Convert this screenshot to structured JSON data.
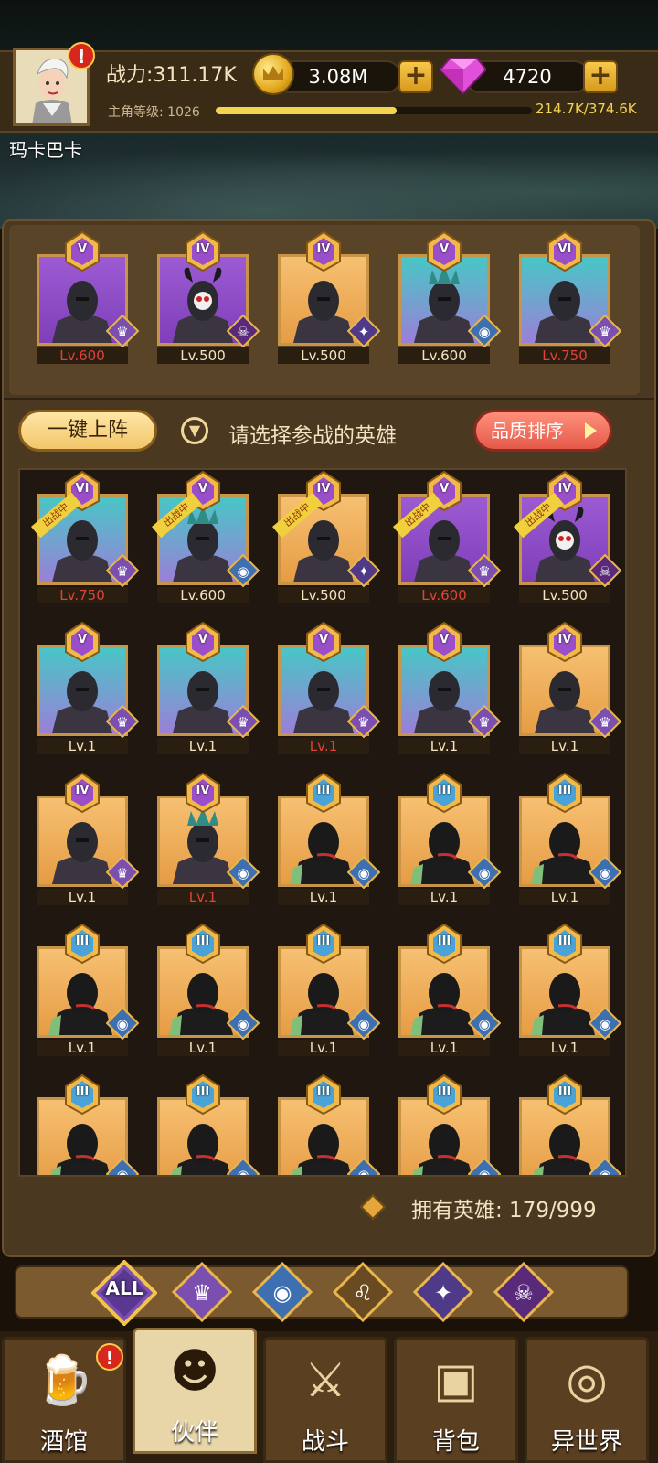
{
  "player": {
    "name": "玛卡巴卡",
    "power": "战力:311.17K",
    "level_label": "主角等级: 1026",
    "exp_text": "214.7K/374.6K",
    "exp_progress": 0.573
  },
  "resources": {
    "gold": "3.08M",
    "gems": "4720"
  },
  "team": [
    {
      "rank": "V",
      "level": "Lv.600",
      "level_red": true,
      "bg": "purple",
      "faction": "crown"
    },
    {
      "rank": "IV",
      "level": "Lv.500",
      "level_red": false,
      "bg": "purple",
      "faction": "demon"
    },
    {
      "rank": "IV",
      "level": "Lv.500",
      "level_red": false,
      "bg": "orange",
      "faction": "elf"
    },
    {
      "rank": "V",
      "level": "Lv.600",
      "level_red": false,
      "bg": "teal",
      "faction": "fish"
    },
    {
      "rank": "VI",
      "level": "Lv.750",
      "level_red": true,
      "bg": "teal",
      "faction": "crown"
    }
  ],
  "controls": {
    "auto_deploy": "一键上阵",
    "prompt": "请选择参战的英雄",
    "sort": "品质排序"
  },
  "heroes": [
    {
      "rank": "VI",
      "level": "Lv.750",
      "level_red": true,
      "bg": "teal",
      "faction": "crown",
      "deployed": "出战中"
    },
    {
      "rank": "V",
      "level": "Lv.600",
      "level_red": false,
      "bg": "teal",
      "faction": "fish",
      "deployed": "出战中"
    },
    {
      "rank": "IV",
      "level": "Lv.500",
      "level_red": false,
      "bg": "orange",
      "faction": "elf",
      "deployed": "出战中"
    },
    {
      "rank": "V",
      "level": "Lv.600",
      "level_red": true,
      "bg": "purple",
      "faction": "crown",
      "deployed": "出战中"
    },
    {
      "rank": "IV",
      "level": "Lv.500",
      "level_red": false,
      "bg": "purple",
      "faction": "demon",
      "deployed": "出战中"
    },
    {
      "rank": "V",
      "level": "Lv.1",
      "level_red": false,
      "bg": "teal",
      "faction": "crown",
      "deployed": ""
    },
    {
      "rank": "V",
      "level": "Lv.1",
      "level_red": false,
      "bg": "teal",
      "faction": "crown",
      "deployed": ""
    },
    {
      "rank": "V",
      "level": "Lv.1",
      "level_red": true,
      "bg": "teal",
      "faction": "crown",
      "deployed": ""
    },
    {
      "rank": "V",
      "level": "Lv.1",
      "level_red": false,
      "bg": "teal",
      "faction": "crown",
      "deployed": ""
    },
    {
      "rank": "IV",
      "level": "Lv.1",
      "level_red": false,
      "bg": "orange",
      "faction": "crown",
      "deployed": ""
    },
    {
      "rank": "IV",
      "level": "Lv.1",
      "level_red": false,
      "bg": "orange",
      "faction": "crown",
      "deployed": ""
    },
    {
      "rank": "IV",
      "level": "Lv.1",
      "level_red": true,
      "bg": "orange",
      "faction": "fish",
      "deployed": ""
    },
    {
      "rank": "III",
      "level": "Lv.1",
      "level_red": false,
      "bg": "orange",
      "faction": "fish",
      "deployed": ""
    },
    {
      "rank": "III",
      "level": "Lv.1",
      "level_red": false,
      "bg": "orange",
      "faction": "fish",
      "deployed": ""
    },
    {
      "rank": "III",
      "level": "Lv.1",
      "level_red": false,
      "bg": "orange",
      "faction": "fish",
      "deployed": ""
    },
    {
      "rank": "III",
      "level": "Lv.1",
      "level_red": false,
      "bg": "orange",
      "faction": "fish",
      "deployed": ""
    },
    {
      "rank": "III",
      "level": "Lv.1",
      "level_red": false,
      "bg": "orange",
      "faction": "fish",
      "deployed": ""
    },
    {
      "rank": "III",
      "level": "Lv.1",
      "level_red": false,
      "bg": "orange",
      "faction": "fish",
      "deployed": ""
    },
    {
      "rank": "III",
      "level": "Lv.1",
      "level_red": false,
      "bg": "orange",
      "faction": "fish",
      "deployed": ""
    },
    {
      "rank": "III",
      "level": "Lv.1",
      "level_red": false,
      "bg": "orange",
      "faction": "fish",
      "deployed": ""
    },
    {
      "rank": "III",
      "level": "",
      "level_red": false,
      "bg": "orange",
      "faction": "fish",
      "deployed": ""
    },
    {
      "rank": "III",
      "level": "",
      "level_red": false,
      "bg": "orange",
      "faction": "fish",
      "deployed": ""
    },
    {
      "rank": "III",
      "level": "",
      "level_red": false,
      "bg": "orange",
      "faction": "fish",
      "deployed": ""
    },
    {
      "rank": "III",
      "level": "",
      "level_red": false,
      "bg": "orange",
      "faction": "fish",
      "deployed": ""
    },
    {
      "rank": "III",
      "level": "",
      "level_red": false,
      "bg": "orange",
      "faction": "fish",
      "deployed": ""
    }
  ],
  "owned": "拥有英雄: 179/999",
  "filters": {
    "all_label": "ALL",
    "factions": [
      "crown",
      "fish",
      "lion",
      "elf",
      "demon"
    ]
  },
  "nav": [
    {
      "label": "酒馆",
      "icon": "tavern-icon",
      "alert": "!"
    },
    {
      "label": "伙伴",
      "icon": "partner-icon",
      "active": true
    },
    {
      "label": "战斗",
      "icon": "battle-icon"
    },
    {
      "label": "背包",
      "icon": "backpack-icon"
    },
    {
      "label": "异世界",
      "icon": "portal-icon"
    }
  ],
  "colors": {
    "purple": "#9a58cf",
    "teal": "#53c3c6",
    "orange": "#f2b45e",
    "level_red": "#e0413a",
    "gold": "#f2d451"
  }
}
